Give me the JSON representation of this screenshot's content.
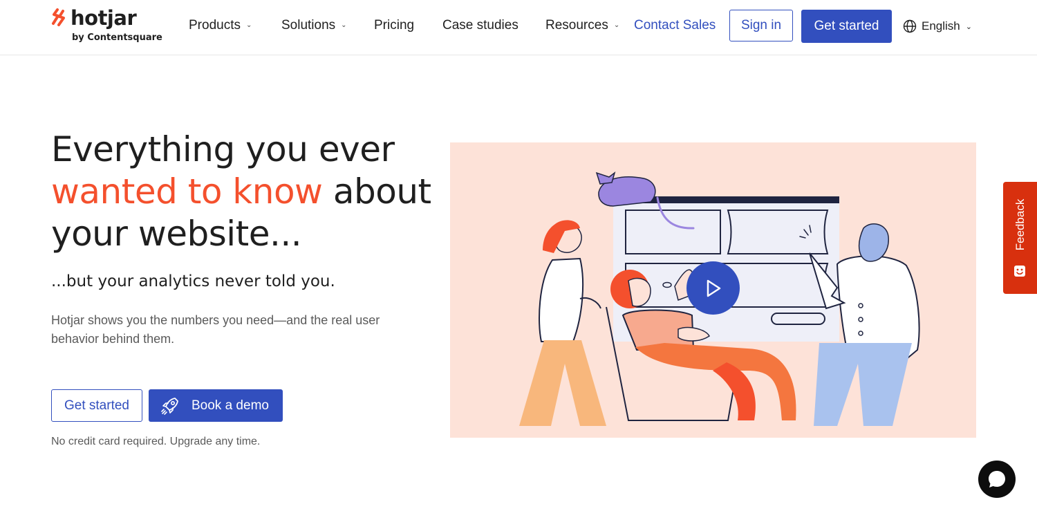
{
  "brand": {
    "name": "hotjar",
    "tagline": "by Contentsquare",
    "accent_color": "#F4502D",
    "primary_color": "#324FBE"
  },
  "nav": {
    "items": [
      {
        "label": "Products",
        "has_dropdown": true
      },
      {
        "label": "Solutions",
        "has_dropdown": true
      },
      {
        "label": "Pricing",
        "has_dropdown": false
      },
      {
        "label": "Case studies",
        "has_dropdown": false
      },
      {
        "label": "Resources",
        "has_dropdown": true
      }
    ],
    "contact_sales": "Contact Sales",
    "sign_in": "Sign in",
    "get_started": "Get started",
    "language": "English"
  },
  "hero": {
    "headline_part1": "Everything you ever",
    "headline_accent": "wanted to know",
    "headline_part2": "about your website...",
    "subhead": "...but your analytics never told you.",
    "description": "Hotjar shows you the numbers you need—and the real user behavior behind them.",
    "primary_cta": "Get started",
    "secondary_cta": "Book a demo",
    "note": "No credit card required. Upgrade any time."
  },
  "illustration": {
    "background_color": "#FDE2D8",
    "play_icon": "play-icon"
  },
  "feedback": {
    "label": "Feedback",
    "color": "#D8300E"
  },
  "chat": {
    "icon": "chat-bubble-icon"
  }
}
